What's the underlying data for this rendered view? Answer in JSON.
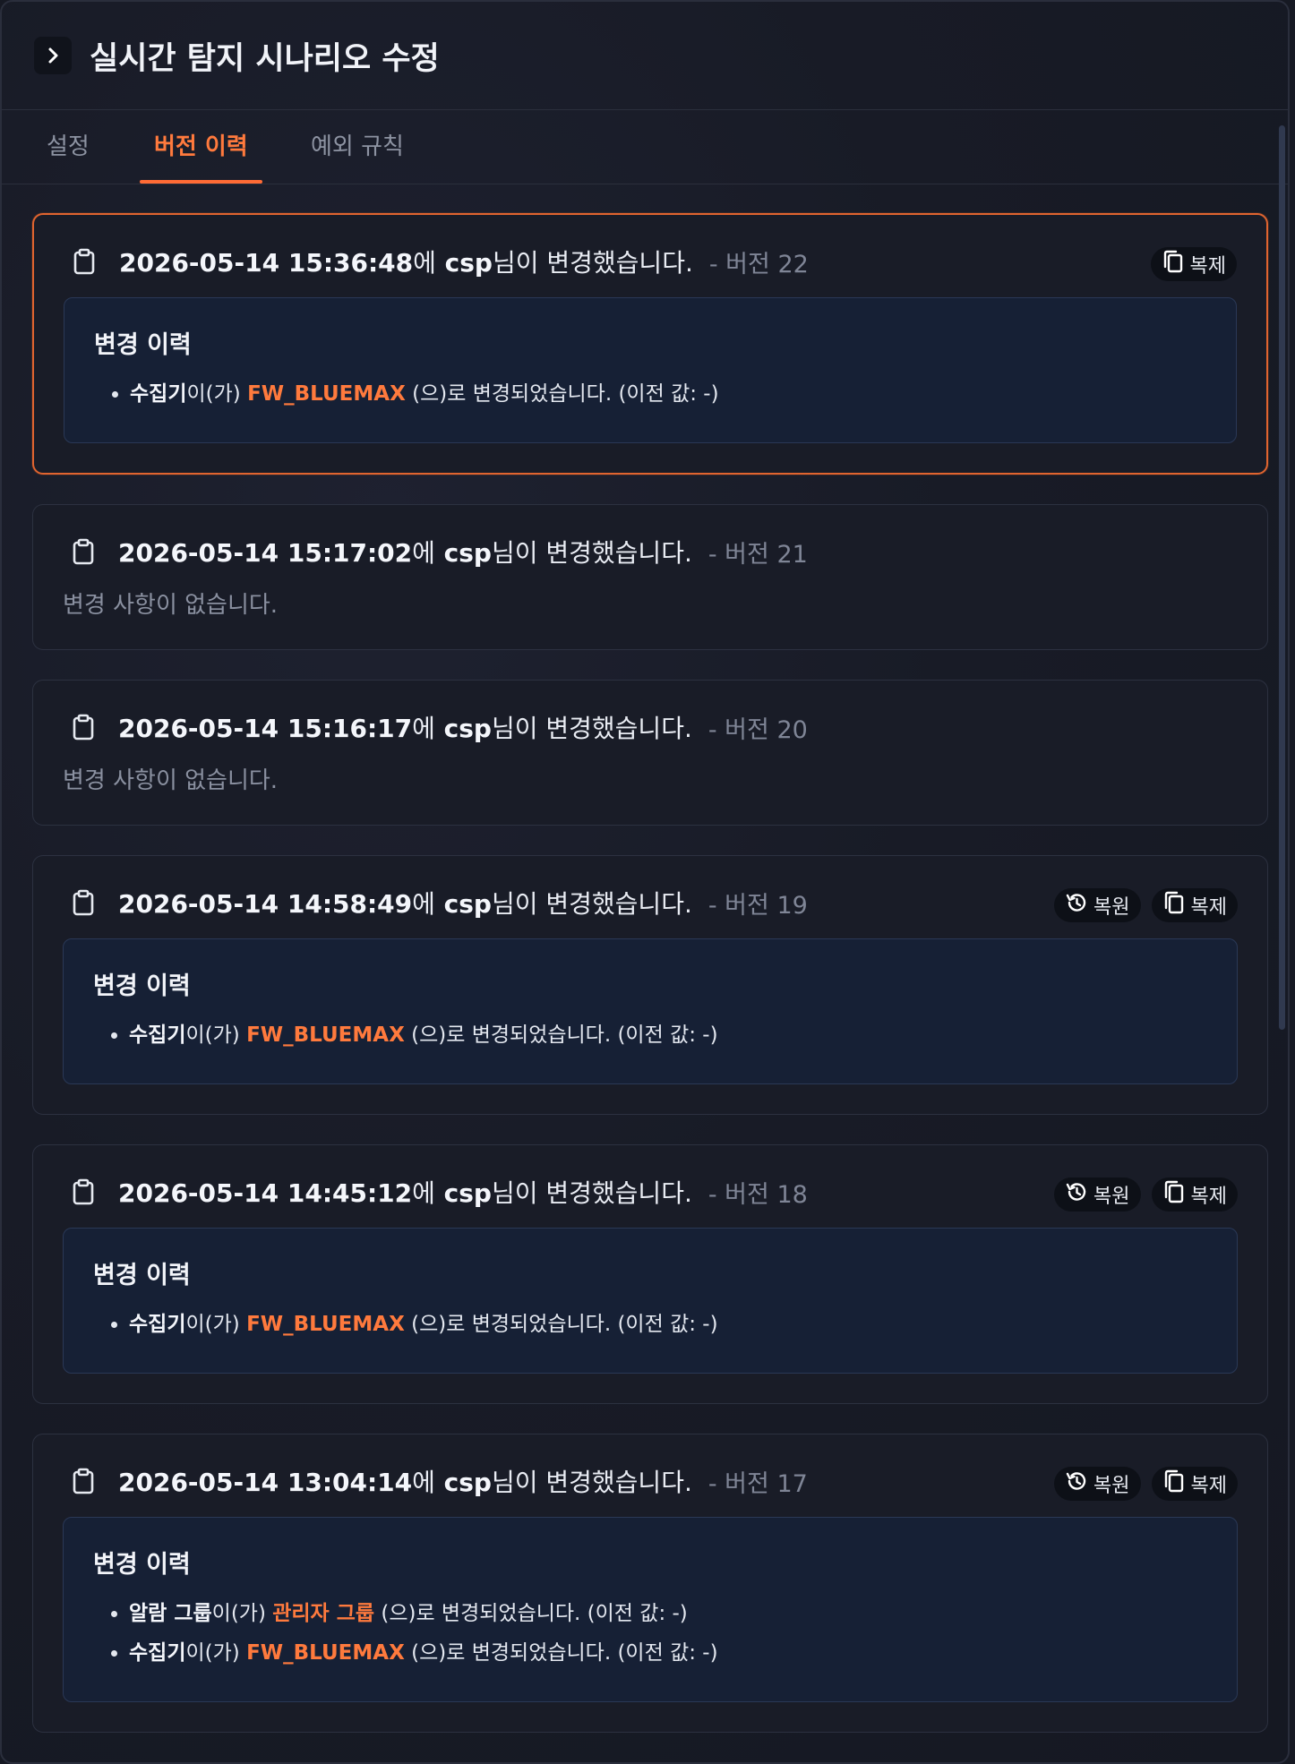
{
  "header": {
    "title": "실시간 탐지 시나리오 수정"
  },
  "tabs": [
    {
      "label": "설정"
    },
    {
      "label": "버전 이력"
    },
    {
      "label": "예외 규칙"
    }
  ],
  "labels": {
    "user_suffix": "님이 변경했습니다.",
    "time_suffix": "에",
    "changes_title": "변경 이력",
    "no_changes": "변경 사항이 없습니다.",
    "restore": "복원",
    "duplicate": "복제",
    "field_connector": "이(가)",
    "change_suffix": " (으)로 변경되었습니다. (이전 값: -)"
  },
  "versions": [
    {
      "timestamp": "2026-05-14 15:36:48",
      "user": "csp",
      "version": "- 버전 22",
      "changes": [
        {
          "field": "수집기",
          "value": "FW_BLUEMAX"
        }
      ]
    },
    {
      "timestamp": "2026-05-14 15:17:02",
      "user": "csp",
      "version": "- 버전 21",
      "changes": []
    },
    {
      "timestamp": "2026-05-14 15:16:17",
      "user": "csp",
      "version": "- 버전 20",
      "changes": []
    },
    {
      "timestamp": "2026-05-14 14:58:49",
      "user": "csp",
      "version": "- 버전 19",
      "changes": [
        {
          "field": "수집기",
          "value": "FW_BLUEMAX"
        }
      ]
    },
    {
      "timestamp": "2026-05-14 14:45:12",
      "user": "csp",
      "version": "- 버전 18",
      "changes": [
        {
          "field": "수집기",
          "value": "FW_BLUEMAX"
        }
      ]
    },
    {
      "timestamp": "2026-05-14 13:04:14",
      "user": "csp",
      "version": "- 버전 17",
      "changes": [
        {
          "field": "알람 그룹",
          "value": "관리자 그룹"
        },
        {
          "field": "수집기",
          "value": "FW_BLUEMAX"
        }
      ]
    }
  ],
  "colors": {
    "accent": "#ff6b35",
    "accent_text": "#ff7a3d",
    "current_border": "#e0642f"
  }
}
